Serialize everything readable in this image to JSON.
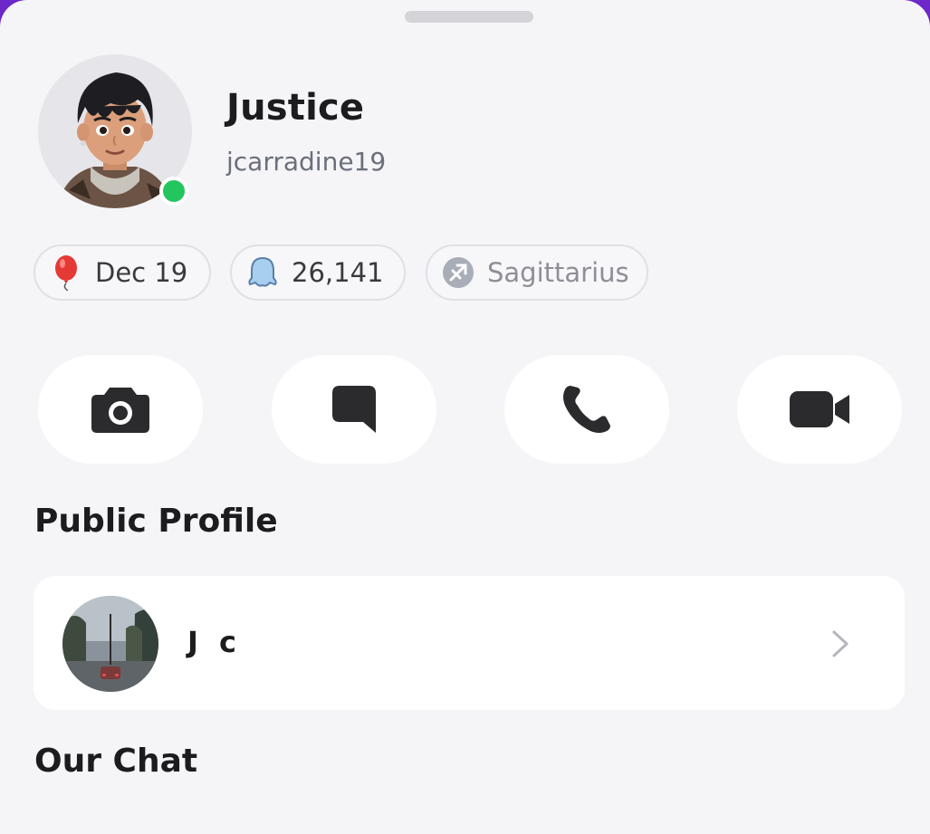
{
  "profile": {
    "display_name": "Justice",
    "username": "jcarradine19",
    "online": true,
    "status_color": "#22c55e"
  },
  "pills": [
    {
      "icon": "balloon-icon",
      "label": "Dec 19"
    },
    {
      "icon": "ghost-icon",
      "label": "26,141"
    },
    {
      "icon": "sagittarius-icon",
      "label": "Sagittarius"
    }
  ],
  "actions": [
    {
      "icon": "camera-icon"
    },
    {
      "icon": "chat-bubble-icon"
    },
    {
      "icon": "phone-icon"
    },
    {
      "icon": "video-icon"
    }
  ],
  "sections": {
    "public_profile_title": "Public Profile",
    "our_chat_title": "Our Chat"
  },
  "public_profile": {
    "name": "J c"
  },
  "colors": {
    "background": "#f5f5f8",
    "card": "#ffffff",
    "text": "#1c1c1e",
    "muted": "#6b6f7a",
    "icon": "#2b2b2e"
  }
}
